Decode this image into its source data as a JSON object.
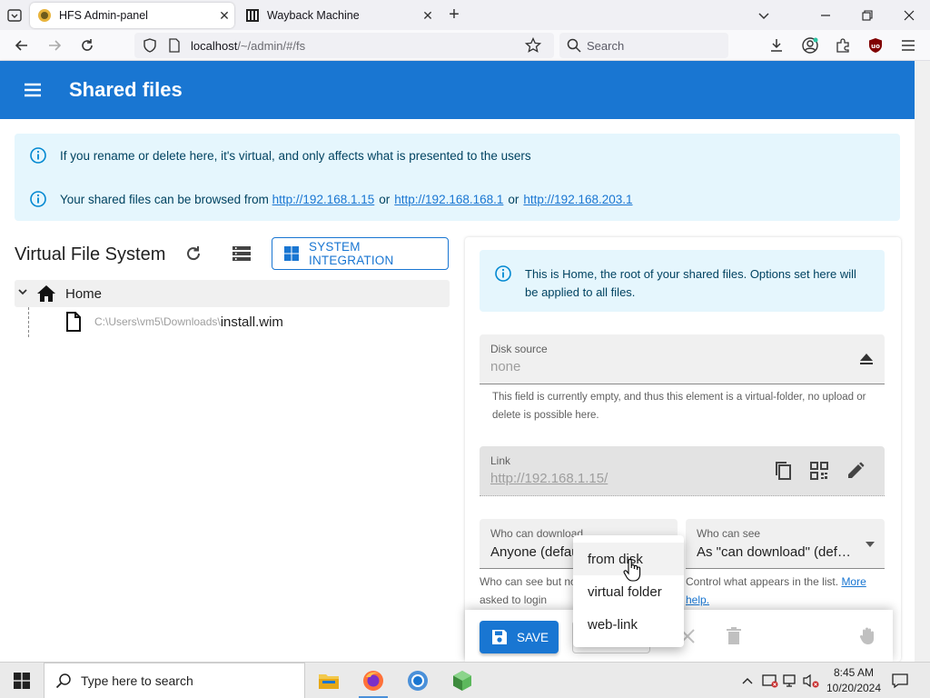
{
  "browser": {
    "tabs": [
      {
        "title": "HFS Admin-panel",
        "active": true
      },
      {
        "title": "Wayback Machine",
        "active": false
      }
    ],
    "url_host": "localhost",
    "url_path": "/~/admin/#/fs",
    "search_placeholder": "Search"
  },
  "app": {
    "title": "Shared files",
    "accent": "#1976d2",
    "info": {
      "line1": "If you rename or delete here, it's virtual, and only affects what is presented to the users",
      "line2_prefix": "Your shared files can be browsed from",
      "links": [
        "http://192.168.1.15",
        "http://192.168.168.1",
        "http://192.168.203.1"
      ],
      "or": "or"
    },
    "vfs": {
      "title": "Virtual File System",
      "system_integration": "SYSTEM INTEGRATION",
      "root": "Home",
      "file_path": "C:\\Users\\vm5\\Downloads\\",
      "file_name": "install.wim"
    },
    "panel": {
      "home_info": "This is Home, the root of your shared files. Options set here will be applied to all files.",
      "disk_source_label": "Disk source",
      "disk_source_value": "none",
      "disk_source_help": "This field is currently empty, and thus this element is a virtual-folder, no upload or delete is possible here.",
      "link_label": "Link",
      "link_value": "http://192.168.1.15/",
      "who_download_label": "Who can download",
      "who_download_value": "Anyone (default)",
      "who_see_label": "Who can see",
      "who_see_value": "As \"can download\" (default)",
      "help_left_1": "Who can see but no",
      "help_left_2": "asked to login",
      "help_right_1": "Control what appears in the list.",
      "help_right_more": "More",
      "help_right_2": "help.",
      "save": "SAVE"
    },
    "dropdown": [
      "from disk",
      "virtual folder",
      "web-link"
    ]
  },
  "taskbar": {
    "search_placeholder": "Type here to search",
    "time": "8:45 AM",
    "date": "10/20/2024"
  }
}
